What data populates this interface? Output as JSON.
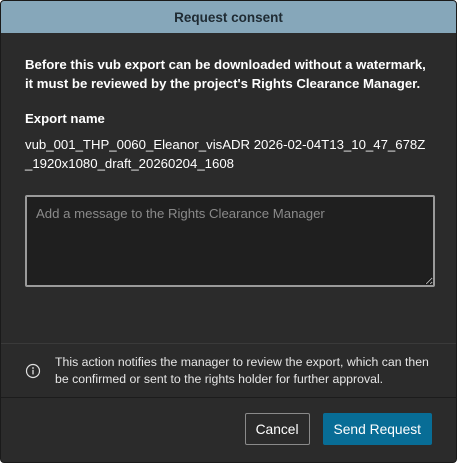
{
  "dialog": {
    "title": "Request consent",
    "intro": "Before this vub export can be downloaded without a watermark, it must be reviewed by the project's Rights Clearance Manager.",
    "export_label": "Export name",
    "export_name": "vub_001_THP_0060_Eleanor_visADR 2026-02-04T13_10_47_678Z_1920x1080_draft_20260204_1608",
    "message": {
      "value": "",
      "placeholder": "Add a message to the Rights Clearance Manager"
    },
    "notice": {
      "icon": "info-icon",
      "text": "This action notifies the manager to review the export, which can then be confirmed or sent to the rights holder for further approval."
    },
    "buttons": {
      "cancel_label": "Cancel",
      "send_label": "Send Request"
    }
  },
  "colors": {
    "title_bar": "#86a7ba",
    "dialog_bg": "#2b2b2b",
    "primary_button": "#086d96"
  }
}
